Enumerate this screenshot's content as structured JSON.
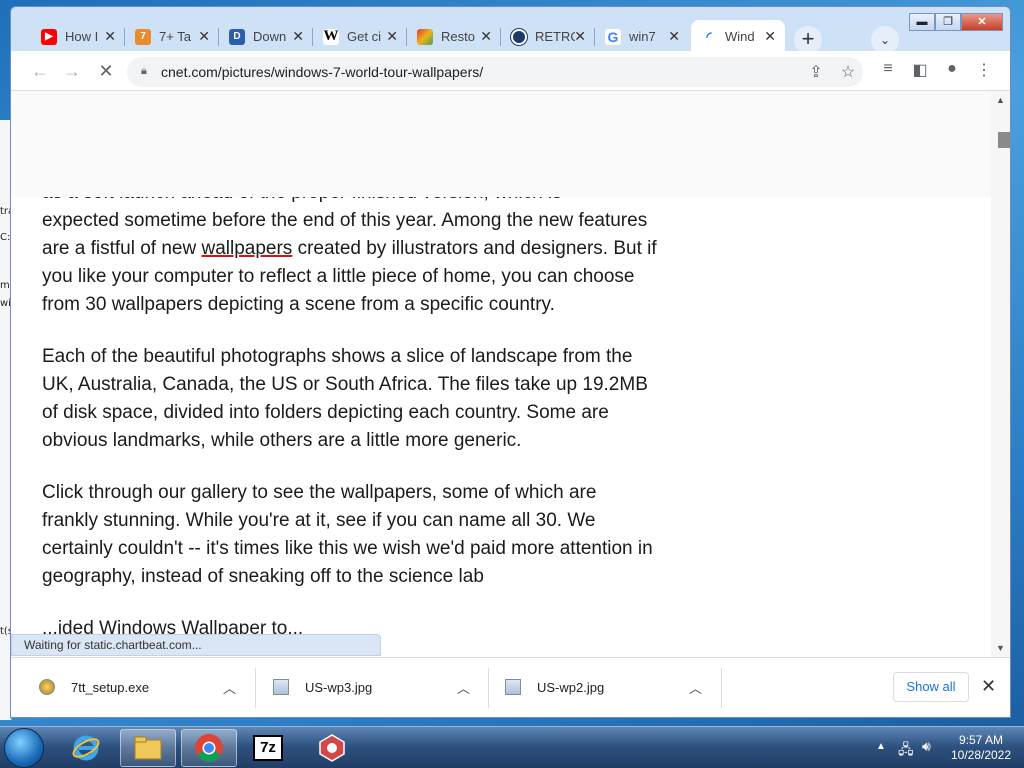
{
  "behind_fragments": [
    "tra",
    "C:",
    "mi",
    "wi",
    "t(s"
  ],
  "tabs": [
    {
      "label": "How I",
      "icon": "youtube-icon",
      "color": "#ff0000"
    },
    {
      "label": "7+ Ta",
      "icon": "page-icon",
      "color": "#e88a2e"
    },
    {
      "label": "Down",
      "icon": "download-site-icon",
      "color": "#2b5fae"
    },
    {
      "label": "Get ci",
      "icon": "wikipedia-icon",
      "color": "#000000"
    },
    {
      "label": "Resto",
      "icon": "restore-icon",
      "color": "#d93f2c"
    },
    {
      "label": "RETRO",
      "icon": "retro-icon",
      "color": "#1c3b6b"
    },
    {
      "label": "win7",
      "icon": "google-icon",
      "color": "#4285f4"
    },
    {
      "label": "Wind",
      "icon": "loading-spinner-icon",
      "color": "#1a73e8"
    }
  ],
  "window_controls": {
    "minimize": "▬",
    "maximize": "❐",
    "close": "✕"
  },
  "url": "cnet.com/pictures/windows-7-world-tour-wallpapers/",
  "article": {
    "p1_top": "as a soft launch ahead of the proper finished version, which is",
    "p1_a": "expected sometime before the end of this year. Among the new features are a fistful of new ",
    "p1_link": "wallpapers",
    "p1_b": " created by illustrators and designers. But if you like your computer to reflect a little piece of home, you can choose from 30 wallpapers depicting a scene from a specific country.",
    "p2": "Each of the beautiful photographs shows a slice of landscape from the UK, Australia, Canada, the US or South Africa. The files take up 19.2MB of disk space, divided into folders depicting each country. Some are obvious landmarks, while others are a little more generic.",
    "p3": "Click through our gallery to see the wallpapers, some of which are frankly stunning. While you're at it, see if you can name all 30. We certainly couldn't -- it's times like this we wish we'd paid more attention in geography, instead of sneaking off to the science lab",
    "p3_tail": "...ided Windows Wallpaper to..."
  },
  "status": "Waiting for static.chartbeat.com...",
  "downloads": [
    {
      "name": "7tt_setup.exe"
    },
    {
      "name": "US-wp3.jpg"
    },
    {
      "name": "US-wp2.jpg"
    }
  ],
  "show_all": "Show all",
  "clock": {
    "time": "9:57 AM",
    "date": "10/28/2022"
  },
  "taskbar_apps": [
    "internet-explorer-icon",
    "file-explorer-icon",
    "chrome-icon",
    "7zip-icon",
    "app-icon"
  ]
}
